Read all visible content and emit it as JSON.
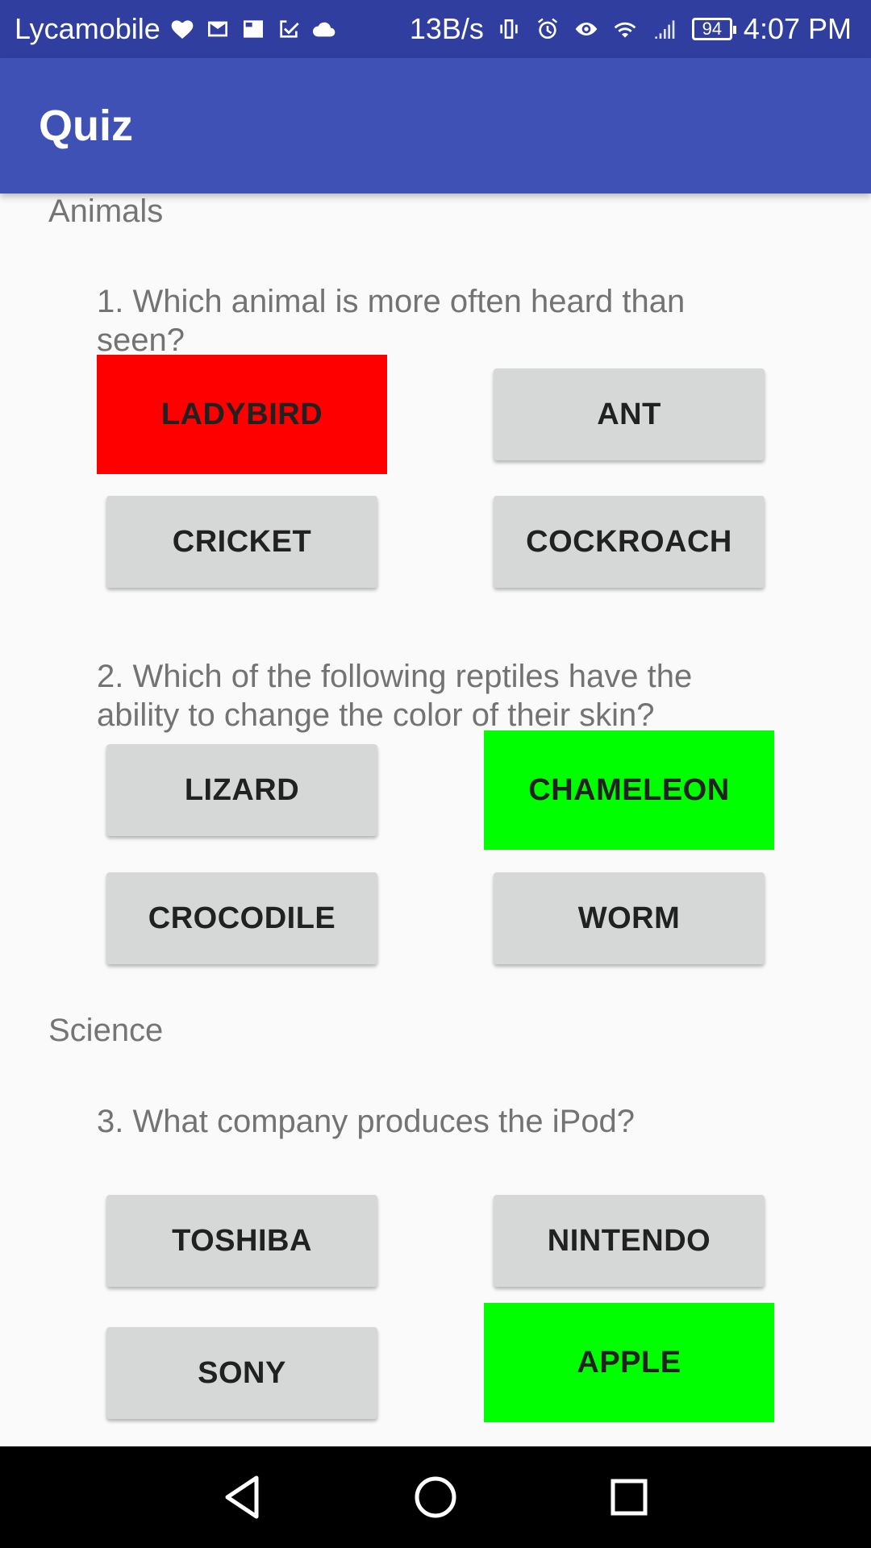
{
  "status_bar": {
    "carrier": "Lycamobile",
    "speed": "13B/s",
    "battery": "94",
    "time": "4:07 PM",
    "icons": [
      "heart-icon",
      "mail-icon",
      "news-icon",
      "check-icon",
      "cloud-icon",
      "vibrate-icon",
      "alarm-icon",
      "eye-icon",
      "wifi-icon",
      "signal-icon"
    ]
  },
  "app_bar": {
    "title": "Quiz"
  },
  "sections": [
    {
      "title": "Animals",
      "questions": [
        {
          "text": "1. Which animal is more often heard than seen?",
          "options": [
            "LADYBIRD",
            "ANT",
            "CRICKET",
            "COCKROACH"
          ],
          "highlight": {
            "LADYBIRD": "wrong"
          }
        },
        {
          "text": "2. Which of the following reptiles have the ability to change the color of their skin?",
          "options": [
            "LIZARD",
            "CHAMELEON",
            "CROCODILE",
            "WORM"
          ],
          "highlight": {
            "CHAMELEON": "correct"
          }
        }
      ]
    },
    {
      "title": "Science",
      "questions": [
        {
          "text": "3. What company produces the iPod?",
          "options": [
            "TOSHIBA",
            "NINTENDO",
            "SONY",
            "APPLE"
          ],
          "highlight": {
            "APPLE": "correct"
          }
        }
      ]
    }
  ],
  "colors": {
    "status_bar": "#303f9f",
    "app_bar": "#3f51b5",
    "button": "#d6d7d7",
    "wrong": "#ff0000",
    "correct": "#00ff00",
    "nav_bar": "#000000"
  },
  "nav_bar": {
    "icons": [
      "back-icon",
      "home-icon",
      "recents-icon"
    ]
  }
}
